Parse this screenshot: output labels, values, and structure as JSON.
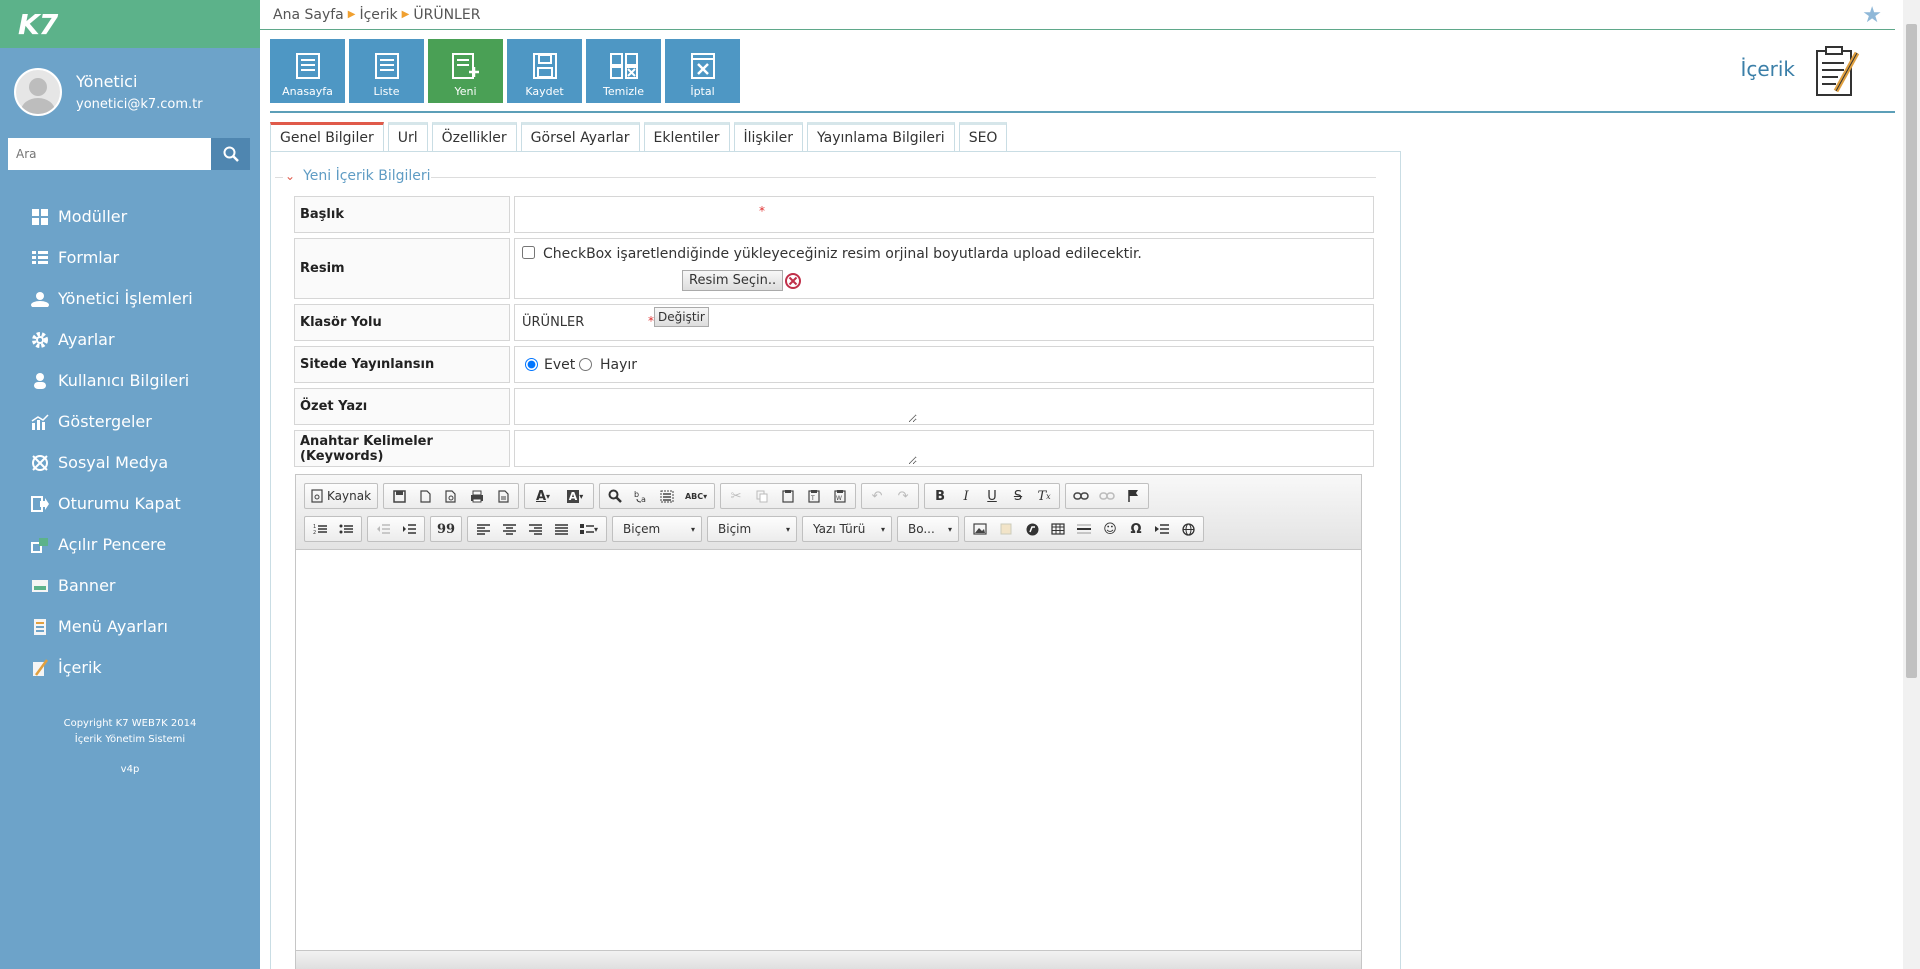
{
  "app": {
    "logo": "K7",
    "user": {
      "name": "Yönetici",
      "email": "yonetici@k7.com.tr"
    },
    "search_placeholder": "Ara",
    "nav": [
      {
        "label": "Modüller",
        "icon": "grid-icon"
      },
      {
        "label": "Formlar",
        "icon": "list-icon"
      },
      {
        "label": "Yönetici İşlemleri",
        "icon": "admin-icon"
      },
      {
        "label": "Ayarlar",
        "icon": "gear-icon"
      },
      {
        "label": "Kullanıcı Bilgileri",
        "icon": "user-icon"
      },
      {
        "label": "Göstergeler",
        "icon": "chart-icon"
      },
      {
        "label": "Sosyal Medya",
        "icon": "social-icon"
      },
      {
        "label": "Oturumu Kapat",
        "icon": "logout-icon"
      },
      {
        "label": "Açılır Pencere",
        "icon": "popup-icon"
      },
      {
        "label": "Banner",
        "icon": "banner-icon"
      },
      {
        "label": "Menü Ayarları",
        "icon": "menu-icon"
      },
      {
        "label": "İçerik",
        "icon": "content-icon"
      }
    ],
    "copyright_1": "Copyright K7 WEB7K 2014",
    "copyright_2": "İçerik Yönetim Sistemi",
    "version": "v4p"
  },
  "breadcrumb": [
    "Ana Sayfa",
    "İçerik",
    "ÜRÜNLER"
  ],
  "toolbar": [
    {
      "label": "Anasayfa",
      "icon": "home-list-icon"
    },
    {
      "label": "Liste",
      "icon": "list-icon"
    },
    {
      "label": "Yeni",
      "icon": "new-icon",
      "active": true
    },
    {
      "label": "Kaydet",
      "icon": "save-icon"
    },
    {
      "label": "Temizle",
      "icon": "clear-icon"
    },
    {
      "label": "İptal",
      "icon": "cancel-icon"
    }
  ],
  "page_heading": "İçerik",
  "tabs": [
    "Genel Bilgiler",
    "Url",
    "Özellikler",
    "Görsel Ayarlar",
    "Eklentiler",
    "İlişkiler",
    "Yayınlama Bilgileri",
    "SEO"
  ],
  "form": {
    "legend": "Yeni İçerik Bilgileri",
    "title_label": "Başlık",
    "title_value": "",
    "image_label": "Resim",
    "image_checkbox_text": "CheckBox işaretlendiğinde yükleyeceğiniz resim orjinal boyutlarda upload edilecektir.",
    "image_button": "Resim Seçin..",
    "folder_label": "Klasör Yolu",
    "folder_value": "ÜRÜNLER",
    "folder_button": "Değiştir",
    "publish_label": "Sitede Yayınlansın",
    "publish_yes": "Evet",
    "publish_no": "Hayır",
    "summary_label": "Özet Yazı",
    "keywords_label": "Anahtar Kelimeler (Keywords)",
    "required_mark": "*"
  },
  "editor": {
    "source_label": "Kaynak",
    "combo_1": "Biçem",
    "combo_2": "Biçim",
    "combo_3": "Yazı Türü",
    "combo_4": "Bo...",
    "bold": "B",
    "italic": "I",
    "underline": "U",
    "strike": "S",
    "quote": "99",
    "omega": "Ω"
  },
  "colors": {
    "sidebar": "#6da3c9",
    "logo_bar": "#5cb28a",
    "toolbar_button": "#4e97c4",
    "toolbar_active": "#4aa055",
    "active_tab": "#e05a4a"
  }
}
